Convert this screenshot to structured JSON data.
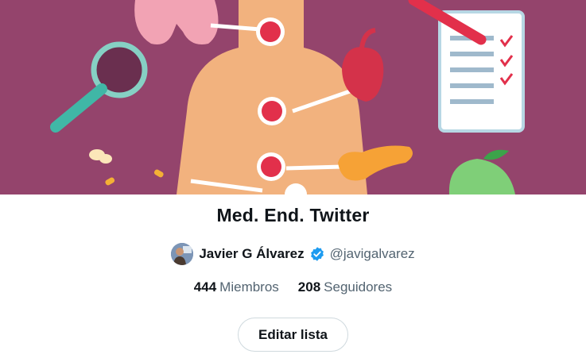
{
  "list": {
    "title": "Med. End. Twitter",
    "owner": {
      "name": "Javier G Álvarez",
      "handle": "@javigalvarez",
      "verified": true,
      "avatar_icon": "user-avatar"
    },
    "stats": {
      "members_count": "444",
      "members_label": "Miembros",
      "followers_count": "208",
      "followers_label": "Seguidores"
    },
    "edit_button_label": "Editar lista"
  },
  "colors": {
    "banner_background": "#94446c",
    "verified_badge": "#1d9bf0",
    "text_primary": "#0f1419",
    "text_secondary": "#536471",
    "button_border": "#cfd9de"
  }
}
